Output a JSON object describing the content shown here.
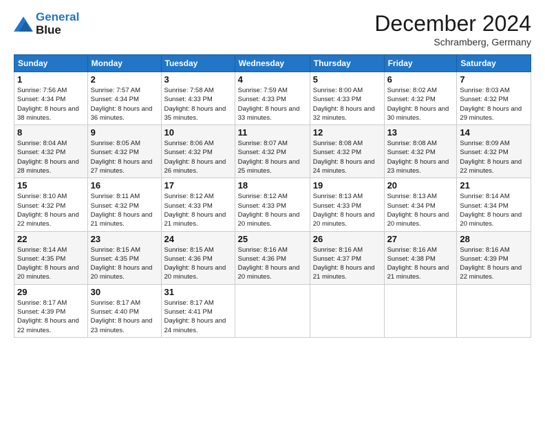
{
  "logo": {
    "line1": "General",
    "line2": "Blue"
  },
  "header": {
    "month": "December 2024",
    "location": "Schramberg, Germany"
  },
  "weekdays": [
    "Sunday",
    "Monday",
    "Tuesday",
    "Wednesday",
    "Thursday",
    "Friday",
    "Saturday"
  ],
  "weeks": [
    [
      {
        "day": "1",
        "sunrise": "7:56 AM",
        "sunset": "4:34 PM",
        "daylight": "8 hours and 38 minutes."
      },
      {
        "day": "2",
        "sunrise": "7:57 AM",
        "sunset": "4:34 PM",
        "daylight": "8 hours and 36 minutes."
      },
      {
        "day": "3",
        "sunrise": "7:58 AM",
        "sunset": "4:33 PM",
        "daylight": "8 hours and 35 minutes."
      },
      {
        "day": "4",
        "sunrise": "7:59 AM",
        "sunset": "4:33 PM",
        "daylight": "8 hours and 33 minutes."
      },
      {
        "day": "5",
        "sunrise": "8:00 AM",
        "sunset": "4:33 PM",
        "daylight": "8 hours and 32 minutes."
      },
      {
        "day": "6",
        "sunrise": "8:02 AM",
        "sunset": "4:32 PM",
        "daylight": "8 hours and 30 minutes."
      },
      {
        "day": "7",
        "sunrise": "8:03 AM",
        "sunset": "4:32 PM",
        "daylight": "8 hours and 29 minutes."
      }
    ],
    [
      {
        "day": "8",
        "sunrise": "8:04 AM",
        "sunset": "4:32 PM",
        "daylight": "8 hours and 28 minutes."
      },
      {
        "day": "9",
        "sunrise": "8:05 AM",
        "sunset": "4:32 PM",
        "daylight": "8 hours and 27 minutes."
      },
      {
        "day": "10",
        "sunrise": "8:06 AM",
        "sunset": "4:32 PM",
        "daylight": "8 hours and 26 minutes."
      },
      {
        "day": "11",
        "sunrise": "8:07 AM",
        "sunset": "4:32 PM",
        "daylight": "8 hours and 25 minutes."
      },
      {
        "day": "12",
        "sunrise": "8:08 AM",
        "sunset": "4:32 PM",
        "daylight": "8 hours and 24 minutes."
      },
      {
        "day": "13",
        "sunrise": "8:08 AM",
        "sunset": "4:32 PM",
        "daylight": "8 hours and 23 minutes."
      },
      {
        "day": "14",
        "sunrise": "8:09 AM",
        "sunset": "4:32 PM",
        "daylight": "8 hours and 22 minutes."
      }
    ],
    [
      {
        "day": "15",
        "sunrise": "8:10 AM",
        "sunset": "4:32 PM",
        "daylight": "8 hours and 22 minutes."
      },
      {
        "day": "16",
        "sunrise": "8:11 AM",
        "sunset": "4:32 PM",
        "daylight": "8 hours and 21 minutes."
      },
      {
        "day": "17",
        "sunrise": "8:12 AM",
        "sunset": "4:33 PM",
        "daylight": "8 hours and 21 minutes."
      },
      {
        "day": "18",
        "sunrise": "8:12 AM",
        "sunset": "4:33 PM",
        "daylight": "8 hours and 20 minutes."
      },
      {
        "day": "19",
        "sunrise": "8:13 AM",
        "sunset": "4:33 PM",
        "daylight": "8 hours and 20 minutes."
      },
      {
        "day": "20",
        "sunrise": "8:13 AM",
        "sunset": "4:34 PM",
        "daylight": "8 hours and 20 minutes."
      },
      {
        "day": "21",
        "sunrise": "8:14 AM",
        "sunset": "4:34 PM",
        "daylight": "8 hours and 20 minutes."
      }
    ],
    [
      {
        "day": "22",
        "sunrise": "8:14 AM",
        "sunset": "4:35 PM",
        "daylight": "8 hours and 20 minutes."
      },
      {
        "day": "23",
        "sunrise": "8:15 AM",
        "sunset": "4:35 PM",
        "daylight": "8 hours and 20 minutes."
      },
      {
        "day": "24",
        "sunrise": "8:15 AM",
        "sunset": "4:36 PM",
        "daylight": "8 hours and 20 minutes."
      },
      {
        "day": "25",
        "sunrise": "8:16 AM",
        "sunset": "4:36 PM",
        "daylight": "8 hours and 20 minutes."
      },
      {
        "day": "26",
        "sunrise": "8:16 AM",
        "sunset": "4:37 PM",
        "daylight": "8 hours and 21 minutes."
      },
      {
        "day": "27",
        "sunrise": "8:16 AM",
        "sunset": "4:38 PM",
        "daylight": "8 hours and 21 minutes."
      },
      {
        "day": "28",
        "sunrise": "8:16 AM",
        "sunset": "4:39 PM",
        "daylight": "8 hours and 22 minutes."
      }
    ],
    [
      {
        "day": "29",
        "sunrise": "8:17 AM",
        "sunset": "4:39 PM",
        "daylight": "8 hours and 22 minutes."
      },
      {
        "day": "30",
        "sunrise": "8:17 AM",
        "sunset": "4:40 PM",
        "daylight": "8 hours and 23 minutes."
      },
      {
        "day": "31",
        "sunrise": "8:17 AM",
        "sunset": "4:41 PM",
        "daylight": "8 hours and 24 minutes."
      },
      null,
      null,
      null,
      null
    ]
  ],
  "labels": {
    "sunrise": "Sunrise:",
    "sunset": "Sunset:",
    "daylight": "Daylight:"
  }
}
